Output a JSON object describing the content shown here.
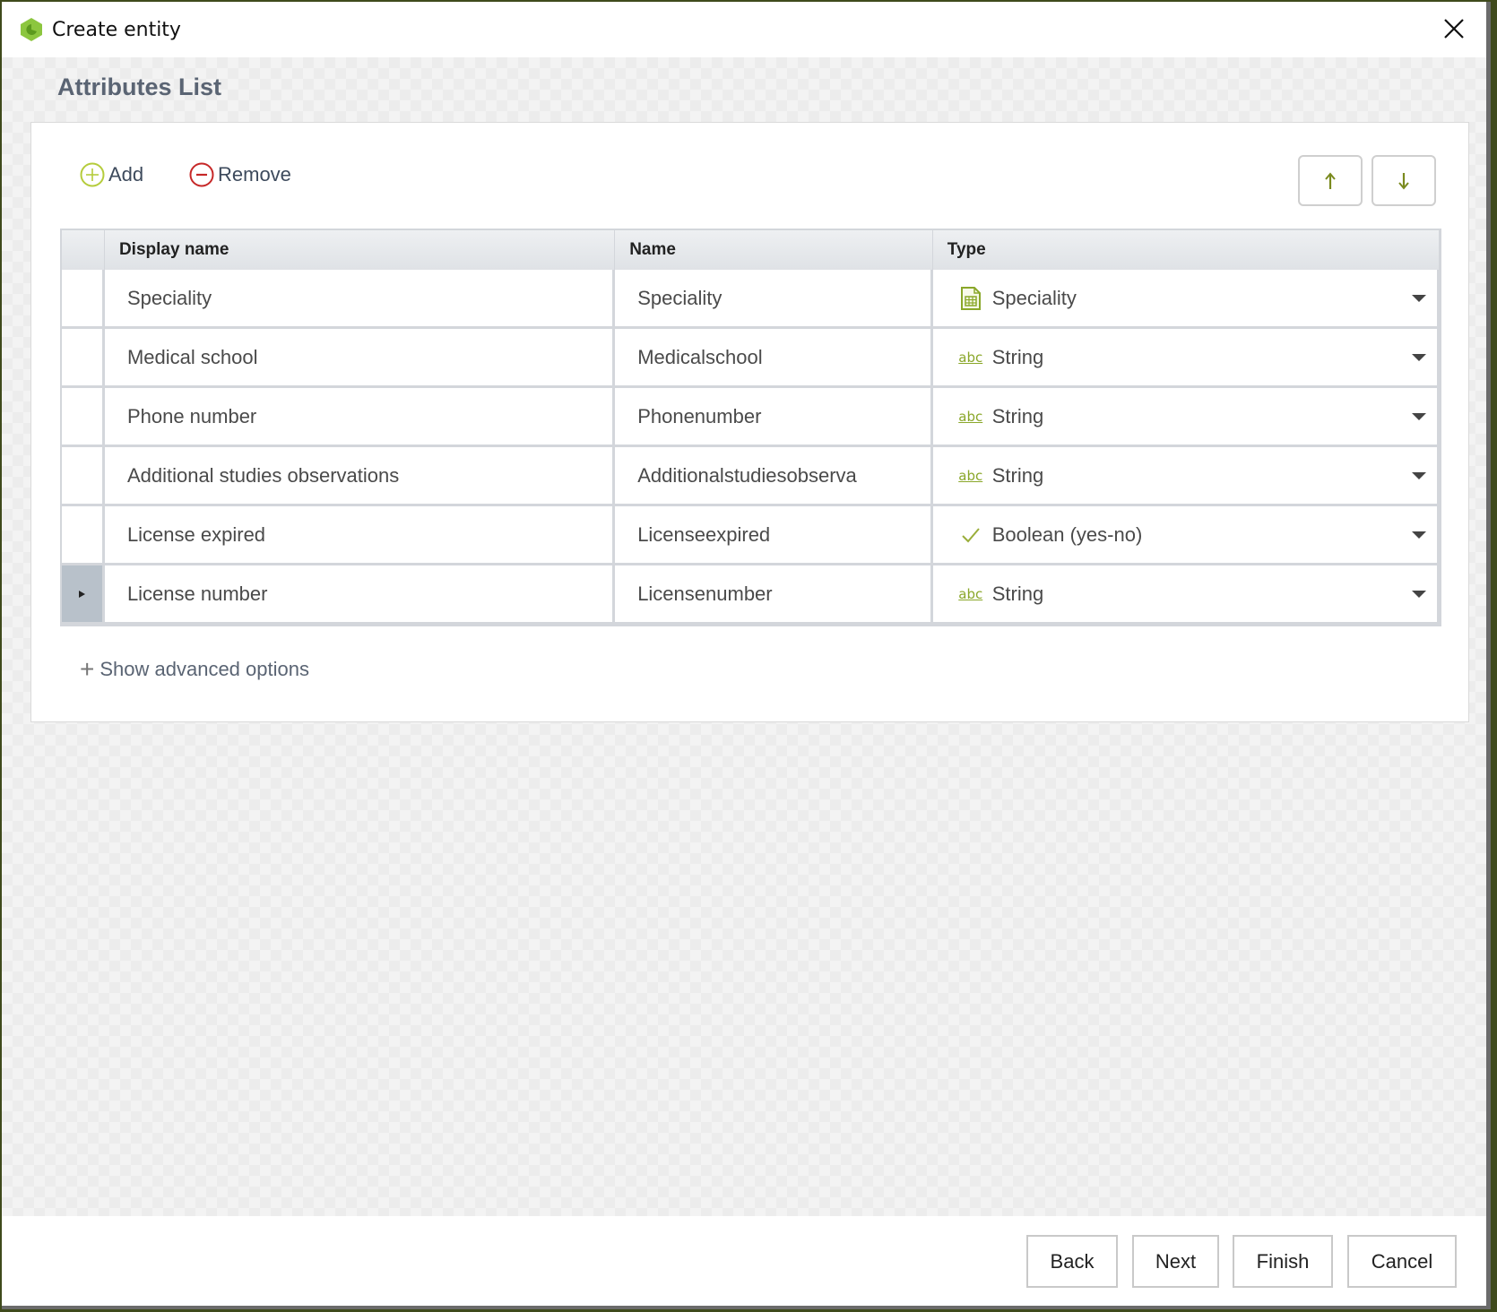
{
  "window": {
    "title": "Create entity",
    "app_icon": "app-logo-icon",
    "close_icon": "close-icon"
  },
  "section": {
    "title": "Attributes List"
  },
  "toolbar": {
    "add_label": "Add",
    "remove_label": "Remove",
    "move_up_icon": "arrow-up-icon",
    "move_down_icon": "arrow-down-icon"
  },
  "grid": {
    "columns": [
      "Display name",
      "Name",
      "Type"
    ],
    "rows": [
      {
        "display_name": "Speciality",
        "name": "Speciality",
        "type": "Speciality",
        "type_icon": "table-document-icon",
        "selected": false
      },
      {
        "display_name": "Medical school",
        "name": "Medicalschool",
        "type": "String",
        "type_icon": "abc-icon",
        "selected": false
      },
      {
        "display_name": "Phone number",
        "name": "Phonenumber",
        "type": "String",
        "type_icon": "abc-icon",
        "selected": false
      },
      {
        "display_name": "Additional studies observations",
        "name": "Additionalstudiesobserva",
        "type": "String",
        "type_icon": "abc-icon",
        "selected": false
      },
      {
        "display_name": "License expired",
        "name": "Licenseexpired",
        "type": "Boolean (yes-no)",
        "type_icon": "checkmark-icon",
        "selected": false
      },
      {
        "display_name": "License number",
        "name": "Licensenumber",
        "type": "String",
        "type_icon": "abc-icon",
        "selected": true
      }
    ],
    "abc_glyph": "abc"
  },
  "advanced": {
    "label": "Show advanced options"
  },
  "footer": {
    "back": "Back",
    "next": "Next",
    "finish": "Finish",
    "cancel": "Cancel"
  },
  "colors": {
    "accent_green": "#8aa72a",
    "remove_red": "#c62828",
    "title_text": "#5a6473"
  }
}
